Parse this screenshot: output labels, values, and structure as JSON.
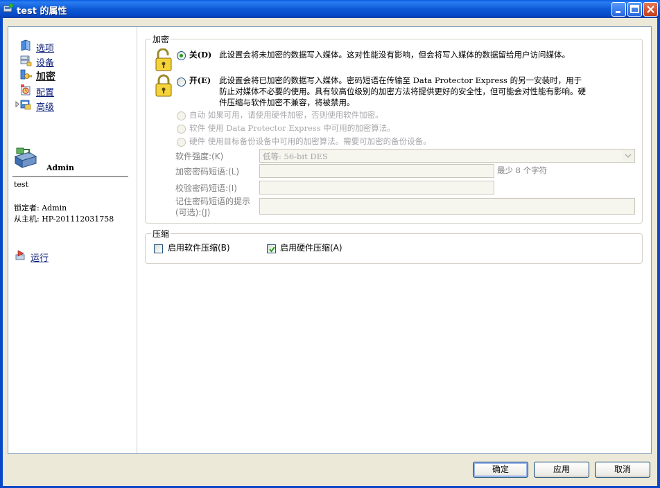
{
  "window": {
    "title": "test 的属性"
  },
  "nav": {
    "items": [
      {
        "label": "选项",
        "icon": "book-icon"
      },
      {
        "label": "设备",
        "icon": "device-icon"
      },
      {
        "label": "加密",
        "icon": "key-icon"
      },
      {
        "label": "配置",
        "icon": "config-icon"
      },
      {
        "label": "高级",
        "icon": "advanced-icon"
      }
    ],
    "active_index": 2
  },
  "user": {
    "name": "Admin",
    "host_label": "test",
    "locked_by": "锁定者: Admin",
    "from_host": "从主机: HP-201112031758"
  },
  "run_link": "运行",
  "encryption": {
    "group_title": "加密",
    "off": {
      "label": "关(D)",
      "desc": "此设置会将未加密的数据写入媒体。这对性能没有影响，但会将写入媒体的数据留给用户访问媒体。",
      "checked": true
    },
    "on": {
      "label": "开(E)",
      "desc_line1": "此设置会将已加密的数据写入媒体。密码短语在传输至 Data Protector Express 的另一安装时，用于",
      "desc_line2": "防止对媒体不必要的使用。具有较高位级别的加密方法将提供更好的安全性，但可能会对性能有影响。硬",
      "desc_line3": "件压缩与软件加密不兼容，将被禁用。",
      "checked": false
    },
    "auto": "自动 如果可用，请使用硬件加密，否则使用软件加密。",
    "software": "软件 使用 Data Protector Express 中可用的加密算法。",
    "hardware": "硬件 使用目标备份设备中可用的加密算法。需要可加密的备份设备。",
    "strength_label": "软件强度:(K)",
    "strength_value": "低等: 56-bit DES",
    "passphrase_label": "加密密码短语:(L)",
    "passphrase_hint": "最少 8 个字符",
    "verify_label": "校验密码短语:(I)",
    "reminder_label_1": "记住密码短语的提示",
    "reminder_label_2": "(可选):(J)"
  },
  "compression": {
    "group_title": "压缩",
    "software_label": "启用软件压缩(B)",
    "software_checked": false,
    "hardware_label": "启用硬件压缩(A)",
    "hardware_checked": true
  },
  "buttons": {
    "ok": "确定",
    "apply": "应用",
    "cancel": "取消"
  }
}
